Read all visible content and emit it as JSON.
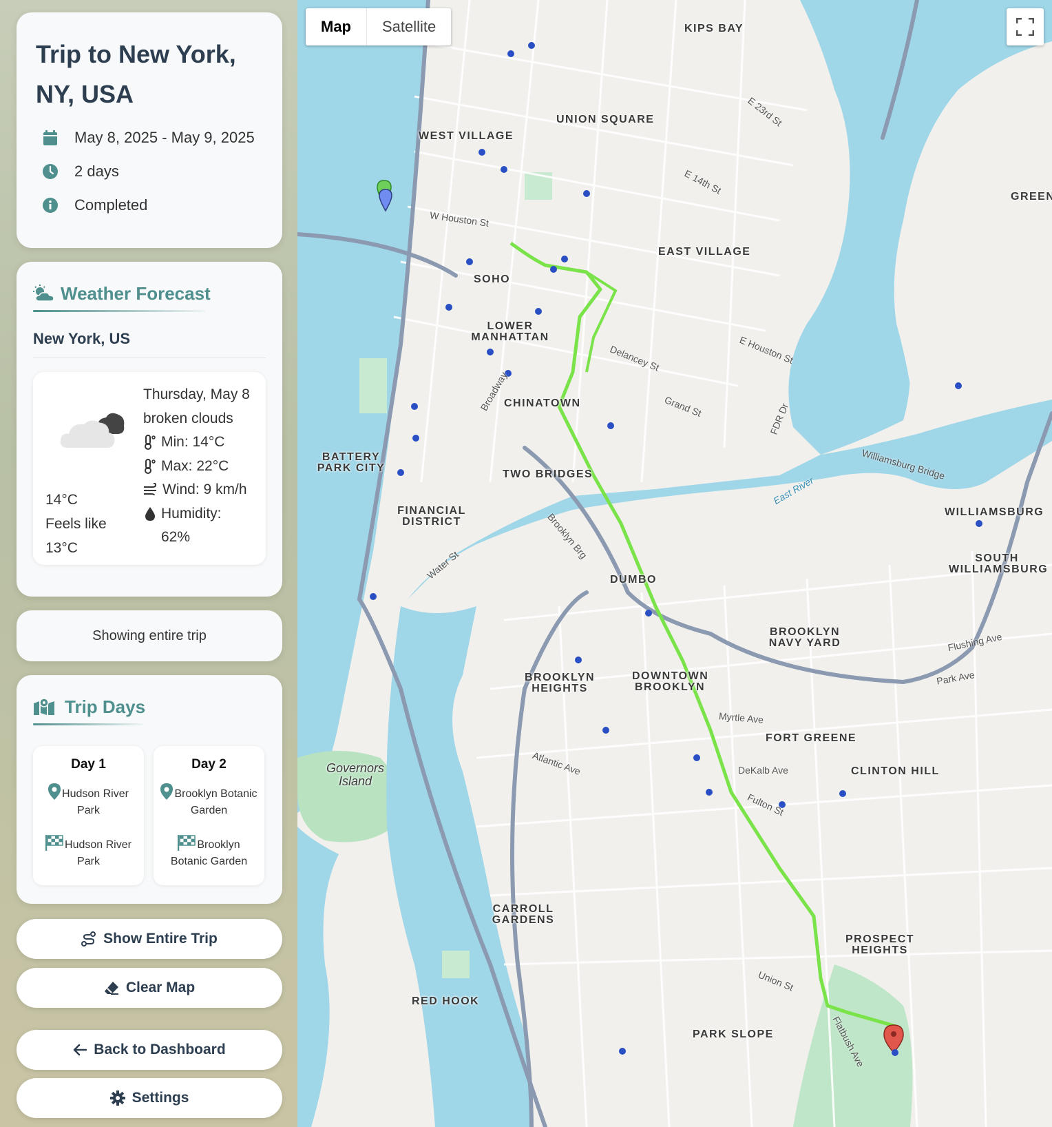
{
  "trip": {
    "title": "Trip to New York, NY, USA",
    "dates": "May 8, 2025 - May 9, 2025",
    "duration": "2 days",
    "status": "Completed"
  },
  "weather": {
    "heading": "Weather Forecast",
    "city": "New York, US",
    "temp": "14°C",
    "feels_like": "Feels like 13°C",
    "day": "Thursday, May 8",
    "condition": "broken clouds",
    "min": "Min: 14°C",
    "max": "Max: 22°C",
    "wind": "Wind: 9 km/h",
    "humidity": "Humidity: 62%"
  },
  "view_status": "Showing entire trip",
  "trip_days": {
    "heading": "Trip Days",
    "days": [
      {
        "title": "Day 1",
        "start": "Hudson River Park",
        "end": "Hudson River Park"
      },
      {
        "title": "Day 2",
        "start": "Brooklyn Botanic Garden",
        "end": "Brooklyn Botanic Garden"
      }
    ]
  },
  "buttons": {
    "show_entire": "Show Entire Trip",
    "clear_map": "Clear Map",
    "back": "Back to Dashboard",
    "settings": "Settings"
  },
  "map": {
    "type_map": "Map",
    "type_satellite": "Satellite",
    "route_color": "#7be34a",
    "neighborhoods": [
      "KIPS BAY",
      "UNION SQUARE",
      "WEST VILLAGE",
      "EAST VILLAGE",
      "SOHO",
      "LOWER MANHATTAN",
      "CHINATOWN",
      "BATTERY PARK CITY",
      "TWO BRIDGES",
      "FINANCIAL DISTRICT",
      "DUMBO",
      "WILLIAMSBURG",
      "SOUTH WILLIAMSBURG",
      "BROOKLYN NAVY YARD",
      "BROOKLYN HEIGHTS",
      "DOWNTOWN BROOKLYN",
      "FORT GREENE",
      "CLINTON HILL",
      "CARROLL GARDENS",
      "PROSPECT HEIGHTS",
      "RED HOOK",
      "PARK SLOPE",
      "Governors Island",
      "GREEN"
    ],
    "streets": [
      "W Houston St",
      "E Houston St",
      "Delancey St",
      "Grand St",
      "Williamsburg Bridge",
      "FDR Dr",
      "Brooklyn Brg",
      "Atlantic Ave",
      "Myrtle Ave",
      "DeKalb Ave",
      "Fulton St",
      "Flatbush Ave",
      "Union St",
      "Park Ave",
      "Flushing Ave",
      "E 14th St",
      "E 23rd St",
      "Broadway",
      "Water St",
      "East River"
    ]
  }
}
